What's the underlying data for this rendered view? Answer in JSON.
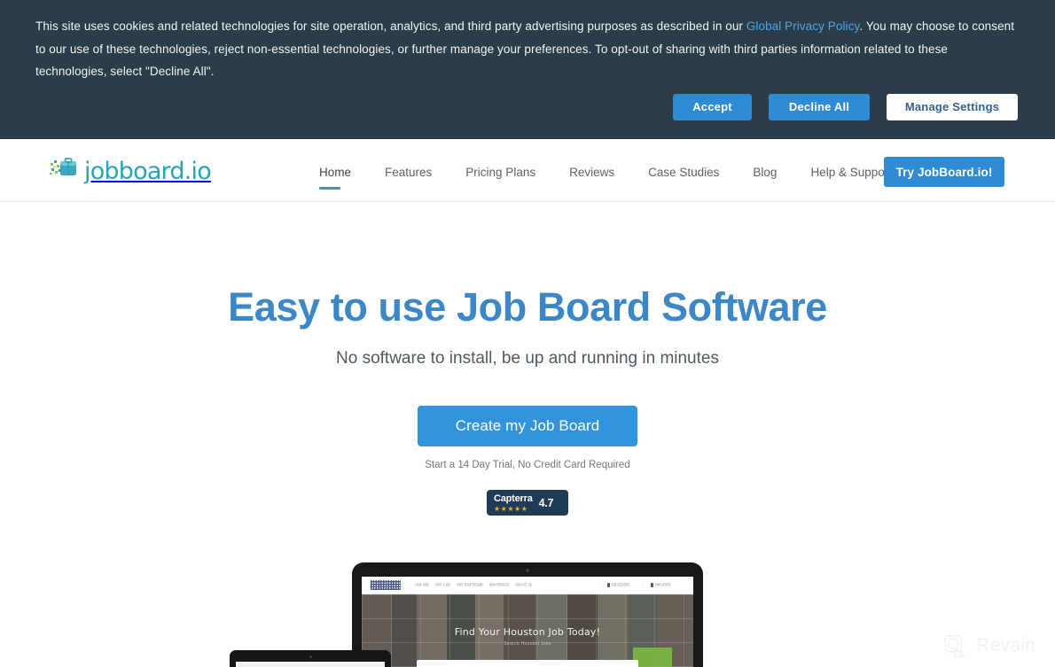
{
  "cookie_banner": {
    "text_before_link": "This site uses cookies and related technologies for site operation, analytics, and third party advertising purposes as described in our ",
    "link_label": "Global Privacy Policy",
    "text_after_link": ". You may choose to consent to our use of these technologies, reject non-essential technologies, or further manage your preferences. To opt-out of sharing with third parties information related to these technologies, select \"Decline All\".",
    "accept_label": "Accept",
    "decline_label": "Decline All",
    "manage_label": "Manage Settings",
    "background_color": "#2a3d48",
    "button_color": "#2e8bd4",
    "link_color": "#4fa3e3"
  },
  "header": {
    "brand_name": "jobboard.io",
    "brand_color": "#2aa3b5",
    "nav_items": [
      {
        "label": "Home",
        "active": true
      },
      {
        "label": "Features",
        "active": false
      },
      {
        "label": "Pricing Plans",
        "active": false
      },
      {
        "label": "Reviews",
        "active": false
      },
      {
        "label": "Case Studies",
        "active": false
      },
      {
        "label": "Blog",
        "active": false
      },
      {
        "label": "Help & Support",
        "active": false
      }
    ],
    "cta_label": "Try JobBoard.io!",
    "cta_color": "#2e8bd4",
    "active_underline_color": "#4a93a8"
  },
  "hero": {
    "title": "Easy to use Job Board Software",
    "title_color": "#3b87c8",
    "subtitle": "No software to install, be up and running in minutes",
    "cta_label": "Create my Job Board",
    "cta_color": "#3194dd",
    "trial_note": "Start a 14 Day Trial, No Credit Card Required"
  },
  "capterra_badge": {
    "name": "Capterra",
    "score": "4.7",
    "stars": "★★★★★",
    "background_color": "#1f3b57",
    "star_color": "#f0ad1f"
  },
  "device_mockup": {
    "laptop_site": {
      "nav_items": [
        "VIEW JOBS",
        "POST A JOB",
        "POST YOUR RESUME",
        "NEW PROFILES",
        "CONTACT US"
      ],
      "account_menus": [
        "JOB SEEKERS",
        "EMPLOYERS"
      ],
      "hero_title": "Find Your Houston Job Today!",
      "hero_subtitle": "Search Houston Jobs"
    }
  },
  "watermark": {
    "label": "Revain",
    "icon": "revain-logo-icon"
  }
}
